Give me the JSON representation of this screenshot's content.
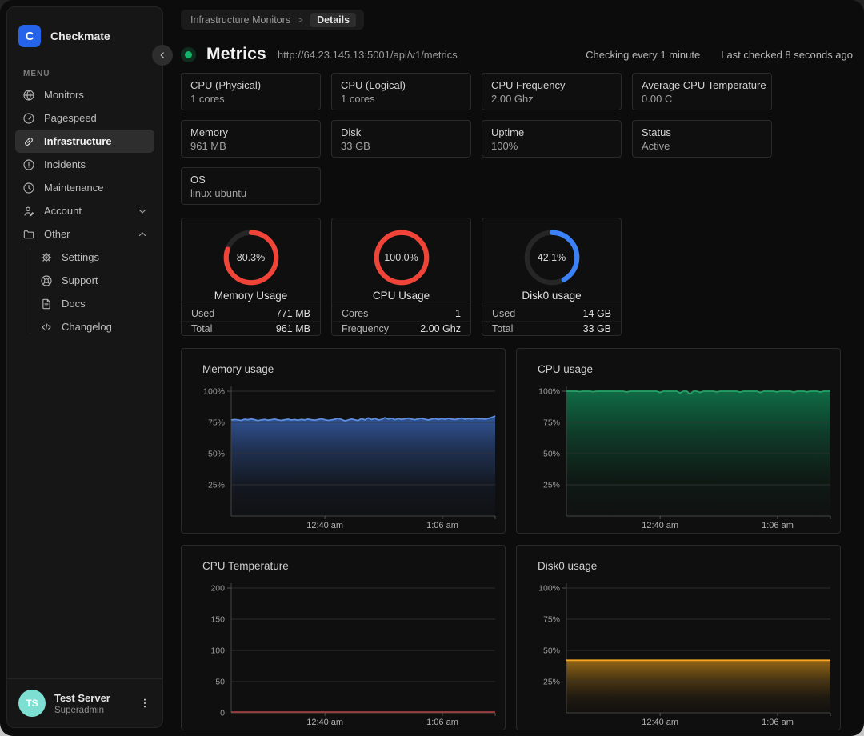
{
  "app": {
    "name": "Checkmate",
    "logo_letter": "C",
    "accent_color": "#2563eb"
  },
  "sidebar": {
    "menu_label": "MENU",
    "items": [
      {
        "label": "Monitors",
        "icon": "globe-icon"
      },
      {
        "label": "Pagespeed",
        "icon": "speedometer-icon"
      },
      {
        "label": "Infrastructure",
        "icon": "link-icon",
        "active": true
      },
      {
        "label": "Incidents",
        "icon": "alert-circle-icon"
      },
      {
        "label": "Maintenance",
        "icon": "clock-icon"
      },
      {
        "label": "Account",
        "icon": "user-icon",
        "chevron": "down"
      },
      {
        "label": "Other",
        "icon": "folder-icon",
        "chevron": "up"
      }
    ],
    "sub_items": [
      {
        "label": "Settings",
        "icon": "gear-icon"
      },
      {
        "label": "Support",
        "icon": "lifebuoy-icon"
      },
      {
        "label": "Docs",
        "icon": "document-icon"
      },
      {
        "label": "Changelog",
        "icon": "code-icon"
      }
    ],
    "user": {
      "initials": "TS",
      "name": "Test Server",
      "role": "Superadmin"
    }
  },
  "breadcrumb": {
    "parent": "Infrastructure Monitors",
    "separator": ">",
    "current": "Details"
  },
  "header": {
    "title": "Metrics",
    "url": "http://64.23.145.13:5001/api/v1/metrics",
    "check_interval": "Checking every 1 minute",
    "last_checked": "Last checked 8 seconds ago",
    "status_color": "#17b26a"
  },
  "info_cards": [
    {
      "label": "CPU (Physical)",
      "value": "1 cores"
    },
    {
      "label": "CPU (Logical)",
      "value": "1 cores"
    },
    {
      "label": "CPU Frequency",
      "value": "2.00 Ghz"
    },
    {
      "label": "Average CPU Temperature",
      "value": "0.00 C"
    },
    {
      "label": "Memory",
      "value": "961 MB"
    },
    {
      "label": "Disk",
      "value": "33 GB"
    },
    {
      "label": "Uptime",
      "value": "100%"
    },
    {
      "label": "Status",
      "value": "Active"
    },
    {
      "label": "OS",
      "value": "linux ubuntu"
    }
  ],
  "gauges": [
    {
      "title": "Memory Usage",
      "percent": 80.3,
      "display": "80.3%",
      "color": "#f04438",
      "rows": [
        {
          "label": "Used",
          "value": "771 MB"
        },
        {
          "label": "Total",
          "value": "961 MB"
        }
      ]
    },
    {
      "title": "CPU Usage",
      "percent": 100.0,
      "display": "100.0%",
      "color": "#f04438",
      "rows": [
        {
          "label": "Cores",
          "value": "1"
        },
        {
          "label": "Frequency",
          "value": "2.00 Ghz"
        }
      ]
    },
    {
      "title": "Disk0 usage",
      "percent": 42.1,
      "display": "42.1%",
      "color": "#3b82f6",
      "rows": [
        {
          "label": "Used",
          "value": "14 GB"
        },
        {
          "label": "Total",
          "value": "33 GB"
        }
      ]
    }
  ],
  "chart_data": [
    {
      "type": "area",
      "title": "Memory usage",
      "ylabel": "",
      "xlabel": "",
      "ylim": [
        0,
        100
      ],
      "yticks": [
        {
          "value": 100,
          "label": "100%"
        },
        {
          "value": 75,
          "label": "75%"
        },
        {
          "value": 50,
          "label": "50%"
        },
        {
          "value": 25,
          "label": "25%"
        }
      ],
      "xticks": [
        {
          "pos": 0.355,
          "label": "12:40 am"
        },
        {
          "pos": 0.8,
          "label": "1:06 am"
        }
      ],
      "line_color": "#5e8ede",
      "fill_color": "#33589f",
      "values": [
        76.9,
        77.3,
        77.0,
        76.6,
        77.5,
        77.1,
        77.8,
        77.2,
        76.5,
        77.0,
        77.4,
        76.8,
        77.2,
        77.6,
        77.0,
        76.6,
        77.1,
        77.5,
        76.9,
        77.3,
        76.8,
        77.4,
        77.0,
        77.6,
        77.1,
        76.7,
        77.3,
        77.9,
        77.2,
        76.6,
        77.0,
        77.5,
        78.2,
        77.4,
        76.3,
        76.9,
        77.7,
        77.1,
        76.5,
        78.0,
        77.0,
        78.6,
        77.3,
        78.2,
        76.9,
        77.4,
        78.8,
        77.7,
        78.3,
        77.2,
        78.0,
        77.4,
        77.9,
        78.4,
        77.6,
        77.2,
        77.8,
        78.3,
        77.5,
        77.0,
        77.6,
        78.1,
        77.4,
        78.0,
        77.5,
        78.2,
        77.7,
        77.3,
        77.9,
        78.4,
        77.6,
        78.1,
        77.7,
        78.3,
        77.8,
        78.0,
        77.6,
        78.2,
        79.0,
        80.2
      ]
    },
    {
      "type": "area",
      "title": "CPU usage",
      "ylabel": "",
      "xlabel": "",
      "ylim": [
        0,
        100
      ],
      "yticks": [
        {
          "value": 100,
          "label": "100%"
        },
        {
          "value": 75,
          "label": "75%"
        },
        {
          "value": 50,
          "label": "50%"
        },
        {
          "value": 25,
          "label": "25%"
        }
      ],
      "xticks": [
        {
          "pos": 0.355,
          "label": "12:40 am"
        },
        {
          "pos": 0.8,
          "label": "1:06 am"
        }
      ],
      "line_color": "#25a368",
      "fill_color": "#0f6f47",
      "values": [
        100,
        100,
        100,
        100,
        99.7,
        100,
        100,
        100,
        99.6,
        100,
        100,
        100,
        100,
        100,
        100,
        100,
        100,
        100,
        99.3,
        100,
        100,
        100,
        100,
        100,
        100,
        100,
        100,
        100,
        99.0,
        100,
        100,
        100,
        100,
        100,
        98.6,
        100,
        100,
        97.7,
        100,
        100,
        99.0,
        100,
        100,
        100,
        100,
        99.4,
        100,
        100,
        100,
        100,
        100,
        100,
        99.2,
        100,
        100,
        100,
        100,
        100,
        99.0,
        100,
        100,
        100,
        100,
        99.4,
        100,
        100,
        100,
        100,
        99.1,
        100,
        100,
        100,
        99.5,
        100,
        100,
        100,
        99.3,
        100,
        100,
        100
      ]
    },
    {
      "type": "line",
      "title": "CPU Temperature",
      "ylabel": "",
      "xlabel": "",
      "ylim": [
        0,
        200
      ],
      "yticks": [
        {
          "value": 200,
          "label": "200"
        },
        {
          "value": 150,
          "label": "150"
        },
        {
          "value": 100,
          "label": "100"
        },
        {
          "value": 50,
          "label": "50"
        },
        {
          "value": 0,
          "label": "0"
        }
      ],
      "xticks": [
        {
          "pos": 0.355,
          "label": "12:40 am"
        },
        {
          "pos": 0.8,
          "label": "1:06 am"
        }
      ],
      "line_color": "#a03d40",
      "fill_color": "#a03d40",
      "values": [
        0,
        0,
        0,
        0,
        0,
        0,
        0,
        0,
        0,
        0,
        0,
        0
      ]
    },
    {
      "type": "area",
      "title": "Disk0 usage",
      "ylabel": "",
      "xlabel": "",
      "ylim": [
        0,
        100
      ],
      "yticks": [
        {
          "value": 100,
          "label": "100%"
        },
        {
          "value": 75,
          "label": "75%"
        },
        {
          "value": 50,
          "label": "50%"
        },
        {
          "value": 25,
          "label": "25%"
        }
      ],
      "xticks": [
        {
          "pos": 0.355,
          "label": "12:40 am"
        },
        {
          "pos": 0.8,
          "label": "1:06 am"
        }
      ],
      "line_color": "#f5a524",
      "fill_color": "#996a15",
      "values": [
        42.1,
        42.1,
        42.1,
        42.1,
        42.1,
        42.1,
        42.1,
        42.1,
        42.1,
        42.1,
        42.1,
        42.1
      ]
    }
  ]
}
